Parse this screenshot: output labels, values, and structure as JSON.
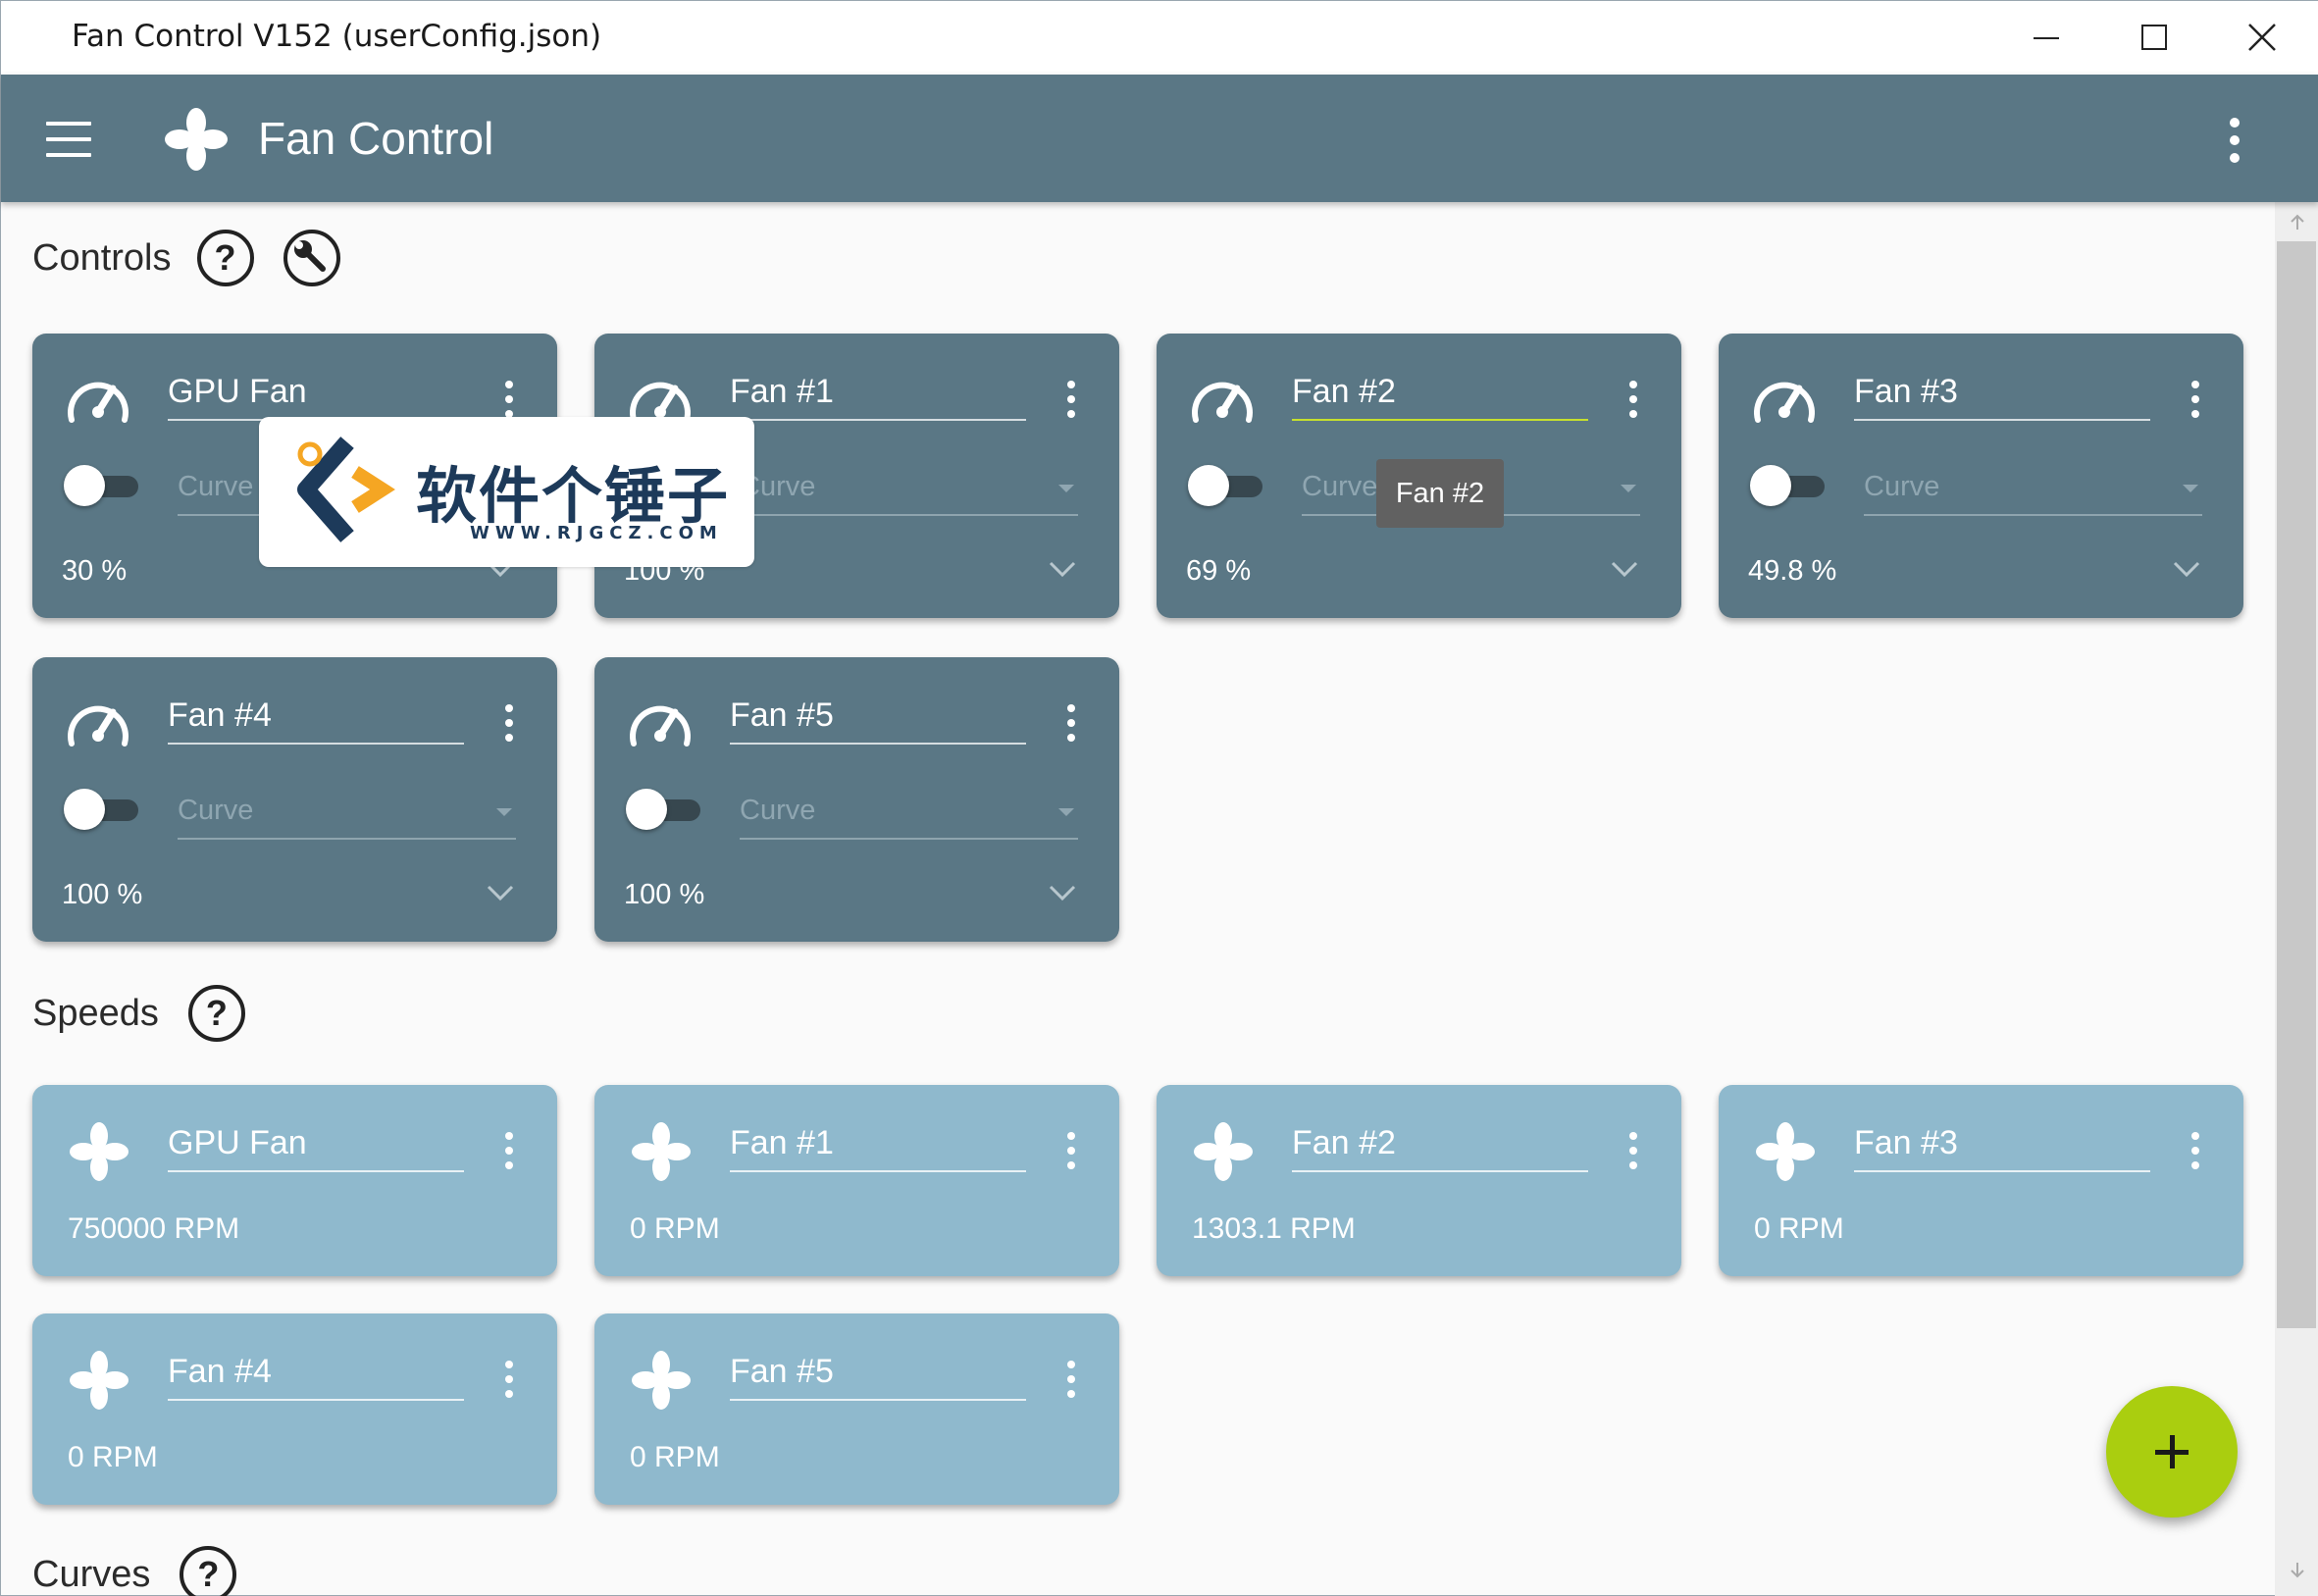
{
  "window": {
    "title": "Fan Control V152 (userConfig.json)"
  },
  "appbar": {
    "title": "Fan Control"
  },
  "sections": {
    "controls": "Controls",
    "speeds": "Speeds",
    "curves": "Curves",
    "help_glyph": "?"
  },
  "controls": [
    {
      "name": "GPU Fan",
      "curve": "Curve",
      "percent": "30 %"
    },
    {
      "name": "Fan #1",
      "curve": "Curve",
      "percent": "100 %"
    },
    {
      "name": "Fan #2",
      "curve": "Curve",
      "percent": "69 %"
    },
    {
      "name": "Fan #3",
      "curve": "Curve",
      "percent": "49.8 %"
    },
    {
      "name": "Fan #4",
      "curve": "Curve",
      "percent": "100 %"
    },
    {
      "name": "Fan #5",
      "curve": "Curve",
      "percent": "100 %"
    }
  ],
  "speeds": [
    {
      "name": "GPU Fan",
      "rpm": "750000 RPM"
    },
    {
      "name": "Fan #1",
      "rpm": "0 RPM"
    },
    {
      "name": "Fan #2",
      "rpm": "1303.1 RPM"
    },
    {
      "name": "Fan #3",
      "rpm": "0 RPM"
    },
    {
      "name": "Fan #4",
      "rpm": "0 RPM"
    },
    {
      "name": "Fan #5",
      "rpm": "0 RPM"
    }
  ],
  "tooltip": "Fan #2",
  "watermark": {
    "text": "软件个锤子",
    "url": "WWW.RJGCZ.COM"
  },
  "colors": {
    "appbar": "#5a7785",
    "control_card": "#5a7785",
    "speed_card": "#8fb9cd",
    "fab": "#aace0f",
    "focus_underline": "#c6e02d"
  }
}
